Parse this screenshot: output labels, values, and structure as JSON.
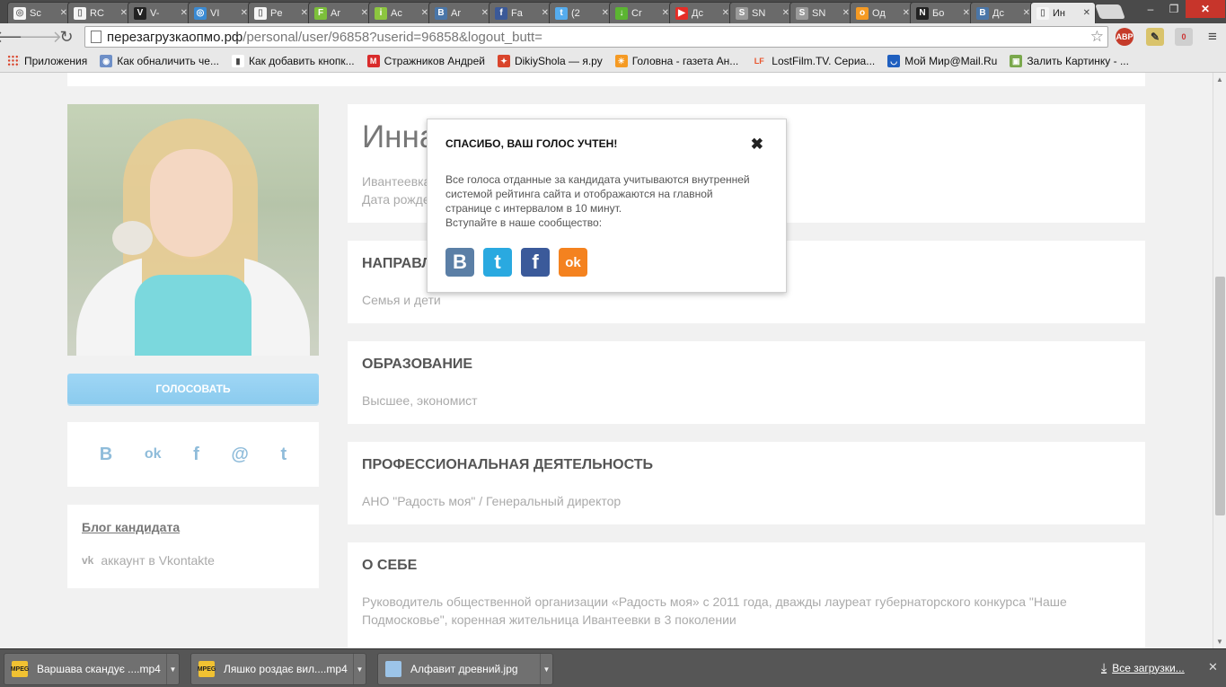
{
  "browser": {
    "tabs": [
      {
        "title": "Sc",
        "color": "#f5f5f5",
        "glyph": "◎"
      },
      {
        "title": "RC",
        "color": "#f5f5f5",
        "glyph": "▯"
      },
      {
        "title": "V-",
        "color": "#222222",
        "glyph": "V"
      },
      {
        "title": "VI",
        "color": "#3b8bd4",
        "glyph": "◎"
      },
      {
        "title": "Pe",
        "color": "#f5f5f5",
        "glyph": "▯"
      },
      {
        "title": "Ar",
        "color": "#7cbf3a",
        "glyph": "F"
      },
      {
        "title": "Ac",
        "color": "#8cc63f",
        "glyph": "i"
      },
      {
        "title": "Ar",
        "color": "#4a76a8",
        "glyph": "B"
      },
      {
        "title": "Fa",
        "color": "#3b5998",
        "glyph": "f"
      },
      {
        "title": "(2",
        "color": "#55acee",
        "glyph": "t"
      },
      {
        "title": "Cr",
        "color": "#5bb531",
        "glyph": "↓"
      },
      {
        "title": "Дс",
        "color": "#e52d27",
        "glyph": "▶"
      },
      {
        "title": "SN",
        "color": "#9a9a9a",
        "glyph": "S"
      },
      {
        "title": "SN",
        "color": "#9a9a9a",
        "glyph": "S"
      },
      {
        "title": "Од",
        "color": "#f59a23",
        "glyph": "o"
      },
      {
        "title": "Бо",
        "color": "#222222",
        "glyph": "N"
      },
      {
        "title": "Дс",
        "color": "#4a76a8",
        "glyph": "B"
      },
      {
        "title": "Ин",
        "color": "#f5f5f5",
        "glyph": "▯",
        "active": true
      }
    ],
    "win_minimize": "–",
    "win_restore": "❐",
    "win_close": "✕",
    "nav_back": "🡐",
    "nav_forward": "🡒",
    "nav_reload": "↻",
    "url_host": "перезагрузкаопмо.рф",
    "url_rest": "/personal/user/96858?userid=96858&logout_butt=",
    "bookmark_star": "☆",
    "ext_abp": "ABP",
    "ext_badge": "0",
    "menu_icon": "≡",
    "bookmarks": [
      {
        "label": "Приложения",
        "icon": "apps-grid-icon"
      },
      {
        "label": "Как обналичить че...",
        "icon": "circle-icon",
        "color": "#6e8fc7",
        "glyph": "◉"
      },
      {
        "label": "Как добавить кнопк...",
        "icon": "page-icon",
        "color": "#ffffff",
        "glyph": "▮"
      },
      {
        "label": "Стражников Андрей",
        "icon": "m-icon",
        "color": "#d92b2b",
        "glyph": "M"
      },
      {
        "label": "DikiyShola — я.ру",
        "icon": "figure-icon",
        "color": "#d9442b",
        "glyph": "✦"
      },
      {
        "label": "Головна - газета Ан...",
        "icon": "sun-icon",
        "color": "#f59a23",
        "glyph": "☀"
      },
      {
        "label": "LostFilm.TV. Сериа...",
        "icon": "lf-icon",
        "color": "#e8e8e8",
        "glyph": "LF"
      },
      {
        "label": "Мой Мир@Mail.Ru",
        "icon": "mailru-icon",
        "color": "#1f5fbf",
        "glyph": "◡"
      },
      {
        "label": "Залить Картинку - ...",
        "icon": "picture-icon",
        "color": "#7aa84c",
        "glyph": "▣"
      }
    ]
  },
  "page": {
    "vote_label": "ГОЛОСОВАТЬ",
    "share_icons": [
      "B",
      "ok",
      "f",
      "@",
      "t"
    ],
    "blog": {
      "title": "Блог кандидата",
      "vk_glyph": "vk",
      "link": "аккаунт в Vkontakte"
    },
    "candidate": {
      "name": "Инна",
      "city": "Ивантеевка",
      "birth_label": "Дата рожде"
    },
    "sections": [
      {
        "title": "НАПРАВЛ",
        "text": "Семья и дети"
      },
      {
        "title": "ОБРАЗОВАНИЕ",
        "text": "Высшее, экономист"
      },
      {
        "title": "ПРОФЕССИОНАЛЬНАЯ ДЕЯТЕЛЬНОСТЬ",
        "text": "АНО \"Радость моя\" / Генеральный директор"
      },
      {
        "title": "О СЕБЕ",
        "text": "Руководитель общественной организации «Радость моя» с 2011 года, дважды лауреат губернаторского конкурса \"Наше Подмосковье\", коренная жительница Ивантеевки в 3 поколении"
      }
    ]
  },
  "modal": {
    "title": "СПАСИБО, ВАШ ГОЛОС УЧТЕН!",
    "close": "✖",
    "body_line1": "Все голоса отданные за кандидата учитываются внутренней системой рейтинга сайта и отображаются на главной странице с интервалом в 10 минут.",
    "body_line2": "Вступайте в наше сообщество:",
    "socials": [
      {
        "glyph": "B",
        "color": "#5b7fa6",
        "name": "vk"
      },
      {
        "glyph": "t",
        "color": "#2aa9e0",
        "name": "twitter"
      },
      {
        "glyph": "f",
        "color": "#3b5a9a",
        "name": "facebook"
      },
      {
        "glyph": "ok",
        "color": "#f4821f",
        "name": "odnoklassniki"
      }
    ]
  },
  "downloads": {
    "items": [
      {
        "name": "Варшава скандує ....mp4",
        "type": "mpeg-file-icon"
      },
      {
        "name": "Ляшко роздає вил....mp4",
        "type": "mpeg-file-icon"
      },
      {
        "name": "Алфавит древний.jpg",
        "type": "image-file-icon"
      }
    ],
    "file_badge": "MPEG",
    "dropdown_glyph": "▼",
    "download_arrow": "⤓",
    "all_label": "Все загрузки...",
    "close_glyph": "✕"
  }
}
